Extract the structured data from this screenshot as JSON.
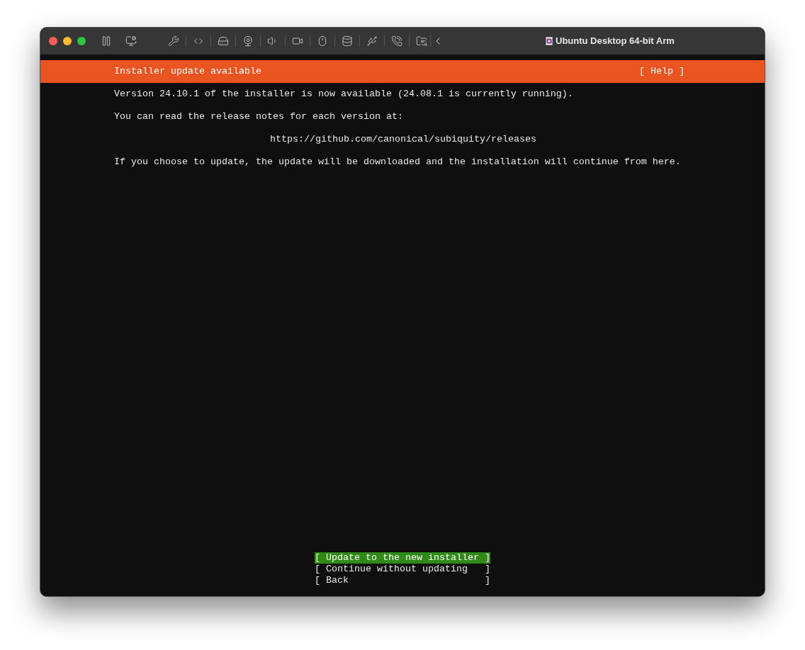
{
  "window": {
    "title": "Ubuntu Desktop 64-bit Arm"
  },
  "header": {
    "title": "Installer update available",
    "help": "[ Help ]"
  },
  "body": [
    {
      "kind": "text",
      "text": "Version 24.10.1 of the installer is now available (24.08.1 is currently running)."
    },
    {
      "kind": "text",
      "text": "You can read the release notes for each version at:"
    },
    {
      "kind": "centered",
      "text": "https://github.com/canonical/subiquity/releases"
    },
    {
      "kind": "text",
      "text": "If you choose to update, the update will be downloaded and the installation will continue from here."
    }
  ],
  "buttons": [
    {
      "label": "[ Update to the new installer ]",
      "selected": true
    },
    {
      "label": "[ Continue without updating   ]",
      "selected": false
    },
    {
      "label": "[ Back                        ]",
      "selected": false
    }
  ]
}
